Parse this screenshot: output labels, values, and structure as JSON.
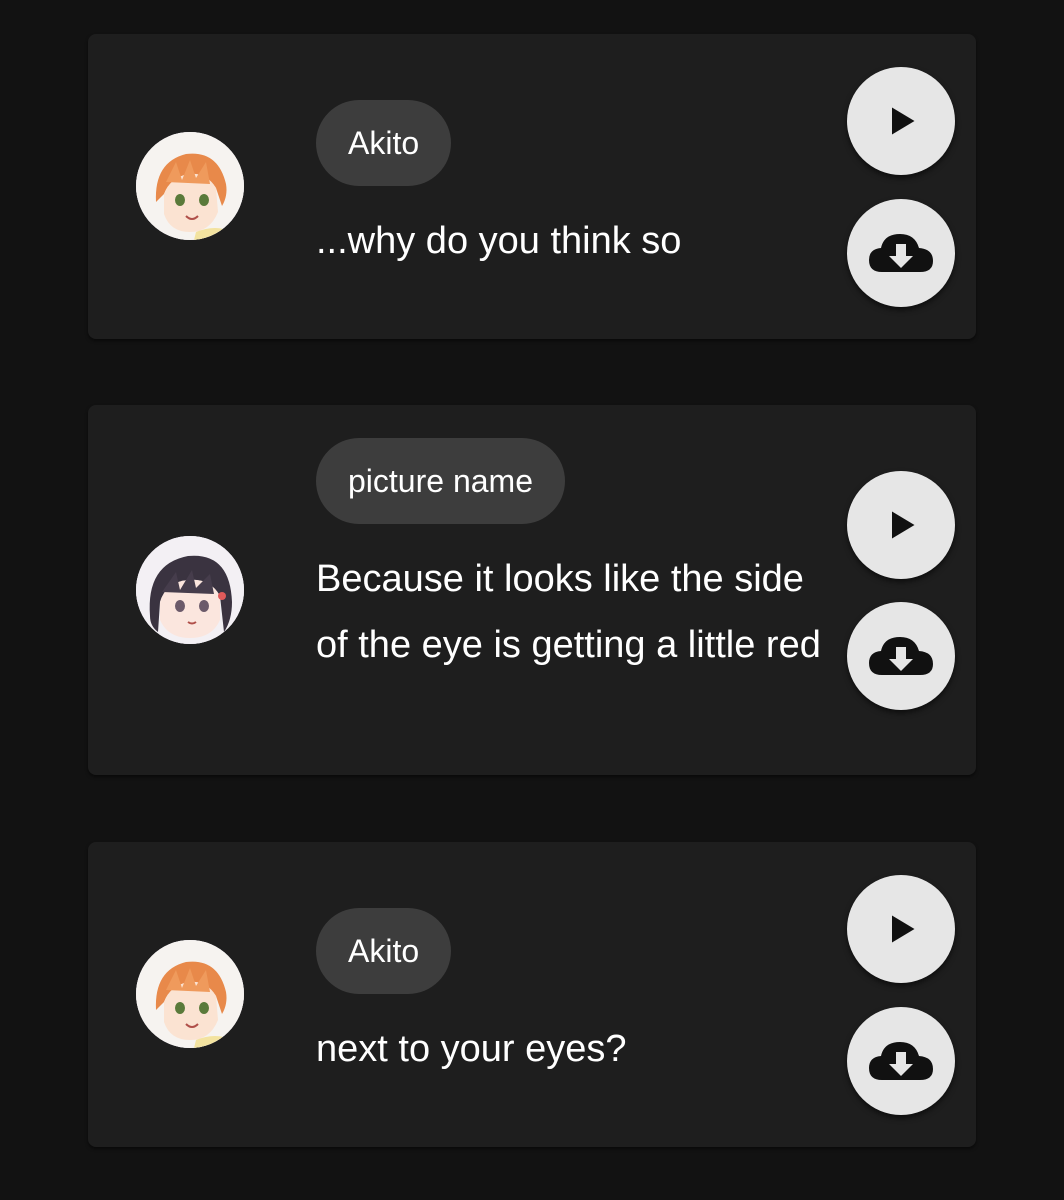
{
  "messages": [
    {
      "speaker": "Akito",
      "text": "...why do you think so",
      "avatar_icon": "akito-avatar-icon",
      "play_icon": "play-icon",
      "download_icon": "cloud-download-icon"
    },
    {
      "speaker": "picture name",
      "text": "Because it looks like the side of the eye is getting a little red",
      "avatar_icon": "dark-haired-avatar-icon",
      "play_icon": "play-icon",
      "download_icon": "cloud-download-icon"
    },
    {
      "speaker": "Akito",
      "text": "next to your eyes?",
      "avatar_icon": "akito-avatar-icon",
      "play_icon": "play-icon",
      "download_icon": "cloud-download-icon"
    }
  ],
  "colors": {
    "background": "#121212",
    "card": "#1e1e1e",
    "name_chip": "#3d3d3d",
    "button": "#e6e6e6",
    "text": "#ffffff"
  }
}
